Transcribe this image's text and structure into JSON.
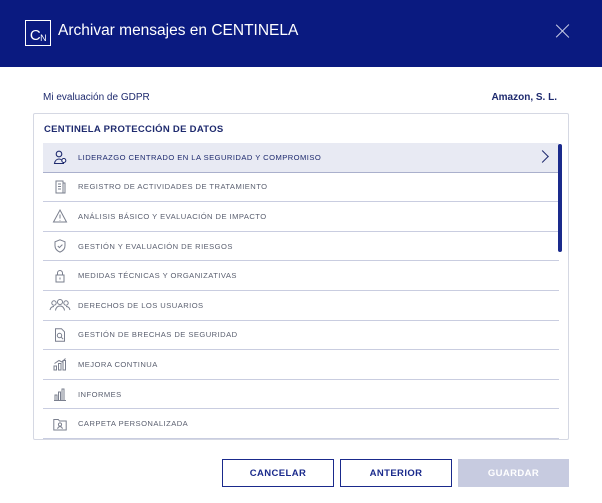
{
  "header": {
    "logo_text_main": "C",
    "logo_text_sub": "N",
    "title": "Archivar mensajes en CENTINELA",
    "close_icon": "close-icon"
  },
  "context": {
    "evaluation": "Mi evaluación de GDPR",
    "company": "Amazon, S. L."
  },
  "panel": {
    "title": "CENTINELA PROTECCIÓN DE DATOS",
    "items": [
      {
        "label": "LIDERAZGO CENTRADO EN LA SEGURIDAD Y COMPROMISO",
        "icon": "leadership-icon",
        "active": true
      },
      {
        "label": "REGISTRO DE ACTIVIDADES DE TRATAMIENTO",
        "icon": "register-icon",
        "active": false
      },
      {
        "label": "ANÁLISIS BÁSICO Y EVALUACIÓN DE IMPACTO",
        "icon": "warning-icon",
        "active": false
      },
      {
        "label": "GESTIÓN Y EVALUACIÓN DE RIESGOS",
        "icon": "shield-check-icon",
        "active": false
      },
      {
        "label": "MEDIDAS TÉCNICAS Y ORGANIZATIVAS",
        "icon": "lock-icon",
        "active": false
      },
      {
        "label": "DERECHOS DE LOS USUARIOS",
        "icon": "users-icon",
        "active": false
      },
      {
        "label": "GESTIÓN DE BRECHAS DE SEGURIDAD",
        "icon": "document-search-icon",
        "active": false
      },
      {
        "label": "MEJORA CONTINUA",
        "icon": "growth-chart-icon",
        "active": false
      },
      {
        "label": "INFORMES",
        "icon": "report-chart-icon",
        "active": false
      },
      {
        "label": "CARPETA PERSONALIZADA",
        "icon": "folder-user-icon",
        "active": false
      }
    ]
  },
  "buttons": {
    "cancel": "CANCELAR",
    "previous": "ANTERIOR",
    "save": "GUARDAR"
  },
  "colors": {
    "header_bg": "#0a1a80",
    "accent": "#1a2a8c",
    "text_dark": "#1e2a6e",
    "disabled_btn": "#c7cbe0"
  }
}
